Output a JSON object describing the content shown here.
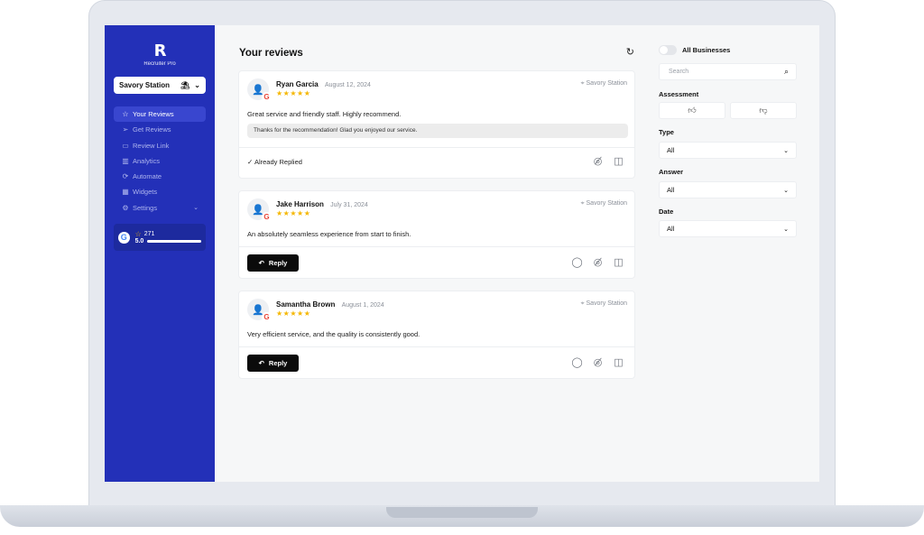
{
  "app": {
    "logo_mark": "R",
    "logo_text": "Recruiter Pro"
  },
  "business_select": {
    "value": "Savory Station"
  },
  "sidebar": {
    "items": [
      {
        "label": "Your Reviews",
        "icon": "star-icon",
        "active": true
      },
      {
        "label": "Get Reviews",
        "icon": "send-icon"
      },
      {
        "label": "Review Link",
        "icon": "monitor-icon"
      },
      {
        "label": "Analytics",
        "icon": "bar-chart-icon"
      },
      {
        "label": "Automate",
        "icon": "automate-icon"
      },
      {
        "label": "Widgets",
        "icon": "widgets-icon"
      },
      {
        "label": "Settings",
        "icon": "gear-icon"
      }
    ],
    "google_card": {
      "count": "271",
      "rating": "5.0"
    }
  },
  "main": {
    "title": "Your reviews",
    "reviews": [
      {
        "name": "Ryan Garcia",
        "date": "August 12, 2024",
        "stars": "★★★★★",
        "location": "Savory Station",
        "text": "Great service and friendly staff. Highly recommend.",
        "reply": "Thanks for the recommendation! Glad you enjoyed our service.",
        "status": "Already Replied"
      },
      {
        "name": "Jake Harrison",
        "date": "July 31, 2024",
        "stars": "★★★★★",
        "location": "Savory Station",
        "text": "An absolutely seamless experience from start to finish.",
        "button": "Reply"
      },
      {
        "name": "Samantha Brown",
        "date": "August 1, 2024",
        "stars": "★★★★★",
        "location": "Savory Station",
        "text": "Very efficient service, and the quality is consistently good.",
        "button": "Reply"
      }
    ]
  },
  "filters": {
    "all_businesses": "All Businesses",
    "search_placeholder": "Search",
    "assessment_label": "Assessment",
    "type_label": "Type",
    "type_value": "All",
    "answer_label": "Answer",
    "answer_value": "All",
    "date_label": "Date",
    "date_value": "All"
  },
  "colors": {
    "sidebar": "#2330b8",
    "star": "#f5b700",
    "button": "#0b0b0b"
  }
}
